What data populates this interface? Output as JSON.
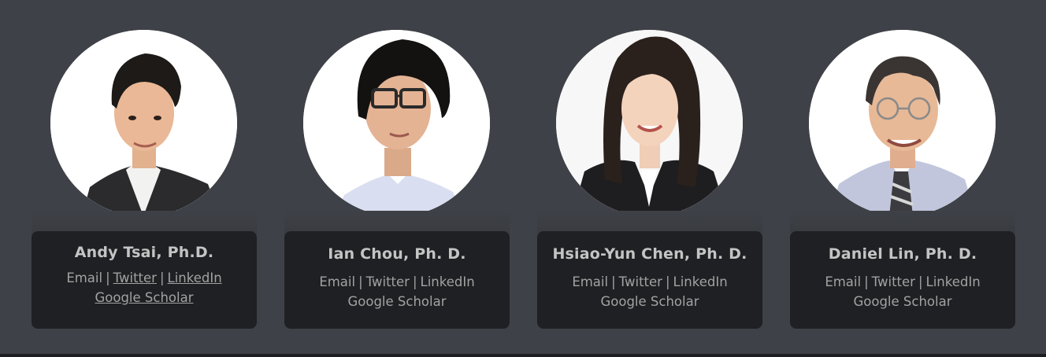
{
  "team": [
    {
      "name": "Andy Tsai, Ph.D.",
      "links": {
        "email": "Email",
        "twitter": "Twitter",
        "linkedin": "LinkedIn",
        "scholar": "Google Scholar"
      },
      "separator": "|"
    },
    {
      "name": "Ian Chou, Ph. D.",
      "links": {
        "email": "Email",
        "twitter": "Twitter",
        "linkedin": "LinkedIn",
        "scholar": "Google Scholar"
      },
      "separator": "|"
    },
    {
      "name": "Hsiao-Yun Chen, Ph. D.",
      "links": {
        "email": "Email",
        "twitter": "Twitter",
        "linkedin": "LinkedIn",
        "scholar": "Google Scholar"
      },
      "separator": "|"
    },
    {
      "name": "Daniel Lin, Ph. D.",
      "links": {
        "email": "Email",
        "twitter": "Twitter",
        "linkedin": "LinkedIn",
        "scholar": "Google Scholar"
      },
      "separator": "|"
    }
  ],
  "colors": {
    "page_background": "#3e4147",
    "card_background": "#1f2023",
    "name_text": "#c4c4c4",
    "link_text": "#a2a2a2"
  }
}
